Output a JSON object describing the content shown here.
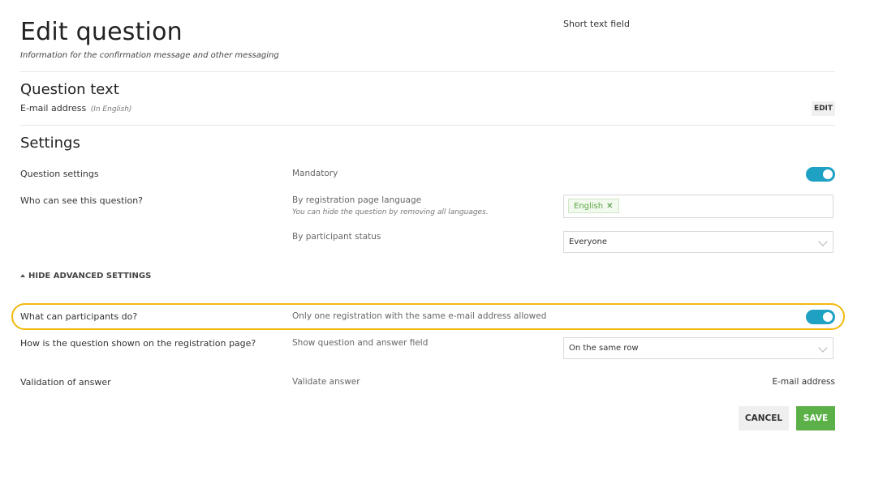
{
  "header": {
    "title": "Edit question",
    "subtitle": "Information for the confirmation message and other messaging",
    "question_type": "Short text field"
  },
  "question_text": {
    "heading": "Question text",
    "value": "E-mail address",
    "language_note": "(In English)",
    "edit_label": "EDIT"
  },
  "settings": {
    "heading": "Settings",
    "question_settings": {
      "label": "Question settings",
      "option": "Mandatory",
      "enabled": true
    },
    "visibility": {
      "label": "Who can see this question?",
      "by_language_label": "By registration page language",
      "by_language_hint": "You can hide the question by removing all languages.",
      "languages": [
        "English"
      ],
      "by_status_label": "By participant status",
      "status_value": "Everyone"
    },
    "advanced_toggle_label": "HIDE ADVANCED SETTINGS",
    "participants": {
      "label": "What can participants do?",
      "option": "Only one registration with the same e-mail address allowed",
      "enabled": true
    },
    "display": {
      "label": "How is the question shown on the registration page?",
      "option": "Show question and answer field",
      "value": "On the same row"
    },
    "validation": {
      "label": "Validation of answer",
      "option": "Validate answer",
      "value": "E-mail address"
    }
  },
  "actions": {
    "cancel_label": "CANCEL",
    "save_label": "SAVE"
  },
  "colors": {
    "toggle_on": "#1fa1c4",
    "highlight": "#f2b90f",
    "save": "#5cb048",
    "tag_text": "#5aa844"
  },
  "icons": {
    "remove_tag": "close-icon",
    "dropdown": "chevron-down-icon",
    "advanced": "triangle-up-icon"
  }
}
